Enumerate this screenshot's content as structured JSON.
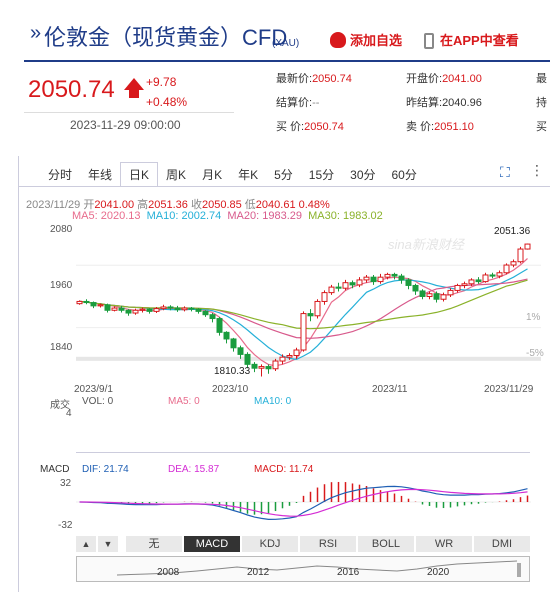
{
  "header": {
    "breadcrumb_arrow": "»",
    "title": "伦敦金（现货黄金）CFD",
    "code": "(XAU)",
    "favorite_label": "添加自选",
    "app_label": "在APP中查看"
  },
  "quote": {
    "price": "2050.74",
    "change": "+9.78",
    "change_pct": "+0.48%",
    "time": "2023-11-29 09:00:00",
    "stats": [
      {
        "label": "最新价:",
        "value": "2050.74"
      },
      {
        "label": "开盘价:",
        "value": "2041.00"
      },
      {
        "label": "最",
        "value": ""
      },
      {
        "label": "结算价:",
        "value": "--"
      },
      {
        "label": "昨结算:",
        "value": "2040.96"
      },
      {
        "label": "持",
        "value": ""
      },
      {
        "label": "买  价:",
        "value": "2050.74"
      },
      {
        "label": "卖  价:",
        "value": "2051.10"
      },
      {
        "label": "买",
        "value": ""
      }
    ]
  },
  "tabs": [
    "分时",
    "年线",
    "日K",
    "周K",
    "月K",
    "年K",
    "5分",
    "15分",
    "30分",
    "60分"
  ],
  "active_tab": "日K",
  "ohlc_line": {
    "date": "2023/11/29",
    "open_label": "开",
    "open": "2041.00",
    "high_label": "高",
    "high": "2051.36",
    "close_label": "收",
    "close": "2050.85",
    "low_label": "低",
    "low": "2040.61",
    "pct": "0.48%"
  },
  "ma_line": {
    "ma5": "MA5: 2020.13",
    "ma10": "MA10: 2002.74",
    "ma20": "MA20: 1983.29",
    "ma30": "MA30: 1983.02"
  },
  "price_axis": [
    "2080",
    "1960",
    "1840"
  ],
  "pct_axis": [
    "1%",
    "-5%"
  ],
  "date_axis": [
    "2023/9/1",
    "2023/10",
    "2023/11",
    "2023/11/29"
  ],
  "high_label": "2051.36",
  "low_label": "1810.33",
  "watermark": "sina新浪财经",
  "volume": {
    "title": "成交",
    "vol": "VOL: 0",
    "ma5": "MA5: 0",
    "ma10": "MA10: 0",
    "axis": "4"
  },
  "macd": {
    "title": "MACD",
    "dif": "DIF: 21.74",
    "dea": "DEA: 15.87",
    "macd": "MACD: 11.74",
    "axis_top": "32",
    "axis_bottom": "-32"
  },
  "indicator_tabs": [
    "无",
    "MACD",
    "KDJ",
    "RSI",
    "BOLL",
    "WR",
    "DMI"
  ],
  "active_indicator": "MACD",
  "navigator_years": [
    "2008",
    "2012",
    "2016",
    "2020"
  ],
  "colors": {
    "up": "#d8191c",
    "down": "#1a9c3e",
    "ma5": "#e86b8c",
    "ma10": "#25b0d8",
    "ma20": "#d85a8c",
    "ma30": "#8ab22a"
  },
  "chart_data": {
    "type": "candlestick",
    "series_ma": [
      "MA5",
      "MA10",
      "MA20",
      "MA30"
    ],
    "candles": [
      [
        1942,
        1946,
        1940,
        1948
      ],
      [
        1946,
        1944,
        1941,
        1950
      ],
      [
        1944,
        1938,
        1934,
        1946
      ],
      [
        1938,
        1940,
        1935,
        1942
      ],
      [
        1940,
        1930,
        1926,
        1942
      ],
      [
        1930,
        1934,
        1928,
        1937
      ],
      [
        1934,
        1930,
        1926,
        1938
      ],
      [
        1930,
        1925,
        1920,
        1932
      ],
      [
        1925,
        1930,
        1922,
        1933
      ],
      [
        1930,
        1932,
        1926,
        1935
      ],
      [
        1932,
        1928,
        1924,
        1934
      ],
      [
        1928,
        1933,
        1925,
        1936
      ],
      [
        1933,
        1936,
        1930,
        1940
      ],
      [
        1936,
        1934,
        1930,
        1939
      ],
      [
        1934,
        1931,
        1927,
        1938
      ],
      [
        1931,
        1934,
        1928,
        1937
      ],
      [
        1934,
        1932,
        1928,
        1936
      ],
      [
        1932,
        1928,
        1924,
        1934
      ],
      [
        1928,
        1922,
        1918,
        1930
      ],
      [
        1922,
        1915,
        1908,
        1925
      ],
      [
        1915,
        1890,
        1884,
        1918
      ],
      [
        1890,
        1878,
        1870,
        1892
      ],
      [
        1878,
        1862,
        1855,
        1880
      ],
      [
        1862,
        1850,
        1842,
        1866
      ],
      [
        1850,
        1832,
        1825,
        1854
      ],
      [
        1832,
        1825,
        1818,
        1836
      ],
      [
        1825,
        1828,
        1810,
        1832
      ],
      [
        1828,
        1824,
        1815,
        1832
      ],
      [
        1824,
        1838,
        1820,
        1842
      ],
      [
        1838,
        1845,
        1832,
        1850
      ],
      [
        1845,
        1848,
        1840,
        1852
      ],
      [
        1848,
        1858,
        1842,
        1862
      ],
      [
        1858,
        1924,
        1855,
        1928
      ],
      [
        1924,
        1920,
        1910,
        1932
      ],
      [
        1920,
        1946,
        1915,
        1950
      ],
      [
        1946,
        1962,
        1940,
        1966
      ],
      [
        1962,
        1972,
        1958,
        1976
      ],
      [
        1972,
        1970,
        1964,
        1980
      ],
      [
        1970,
        1980,
        1966,
        1985
      ],
      [
        1980,
        1976,
        1970,
        1984
      ],
      [
        1976,
        1985,
        1972,
        1990
      ],
      [
        1985,
        1990,
        1980,
        1994
      ],
      [
        1990,
        1982,
        1976,
        1994
      ],
      [
        1982,
        1990,
        1978,
        1996
      ],
      [
        1990,
        1995,
        1986,
        1998
      ],
      [
        1995,
        1992,
        1986,
        1998
      ],
      [
        1992,
        1985,
        1978,
        1996
      ],
      [
        1985,
        1975,
        1968,
        1988
      ],
      [
        1975,
        1965,
        1958,
        1978
      ],
      [
        1965,
        1955,
        1950,
        1968
      ],
      [
        1955,
        1960,
        1950,
        1964
      ],
      [
        1960,
        1950,
        1944,
        1964
      ],
      [
        1950,
        1958,
        1946,
        1962
      ],
      [
        1958,
        1966,
        1954,
        1970
      ],
      [
        1966,
        1975,
        1962,
        1978
      ],
      [
        1975,
        1978,
        1970,
        1982
      ],
      [
        1978,
        1985,
        1974,
        1988
      ],
      [
        1985,
        1982,
        1978,
        1990
      ],
      [
        1982,
        1994,
        1980,
        1998
      ],
      [
        1994,
        1992,
        1988,
        1998
      ],
      [
        1992,
        1998,
        1988,
        2002
      ],
      [
        1998,
        2012,
        1995,
        2015
      ],
      [
        2012,
        2018,
        2008,
        2022
      ],
      [
        2018,
        2041,
        2015,
        2045
      ],
      [
        2041,
        2050,
        2040,
        2051
      ]
    ],
    "ylim": [
      1800,
      2090
    ]
  }
}
